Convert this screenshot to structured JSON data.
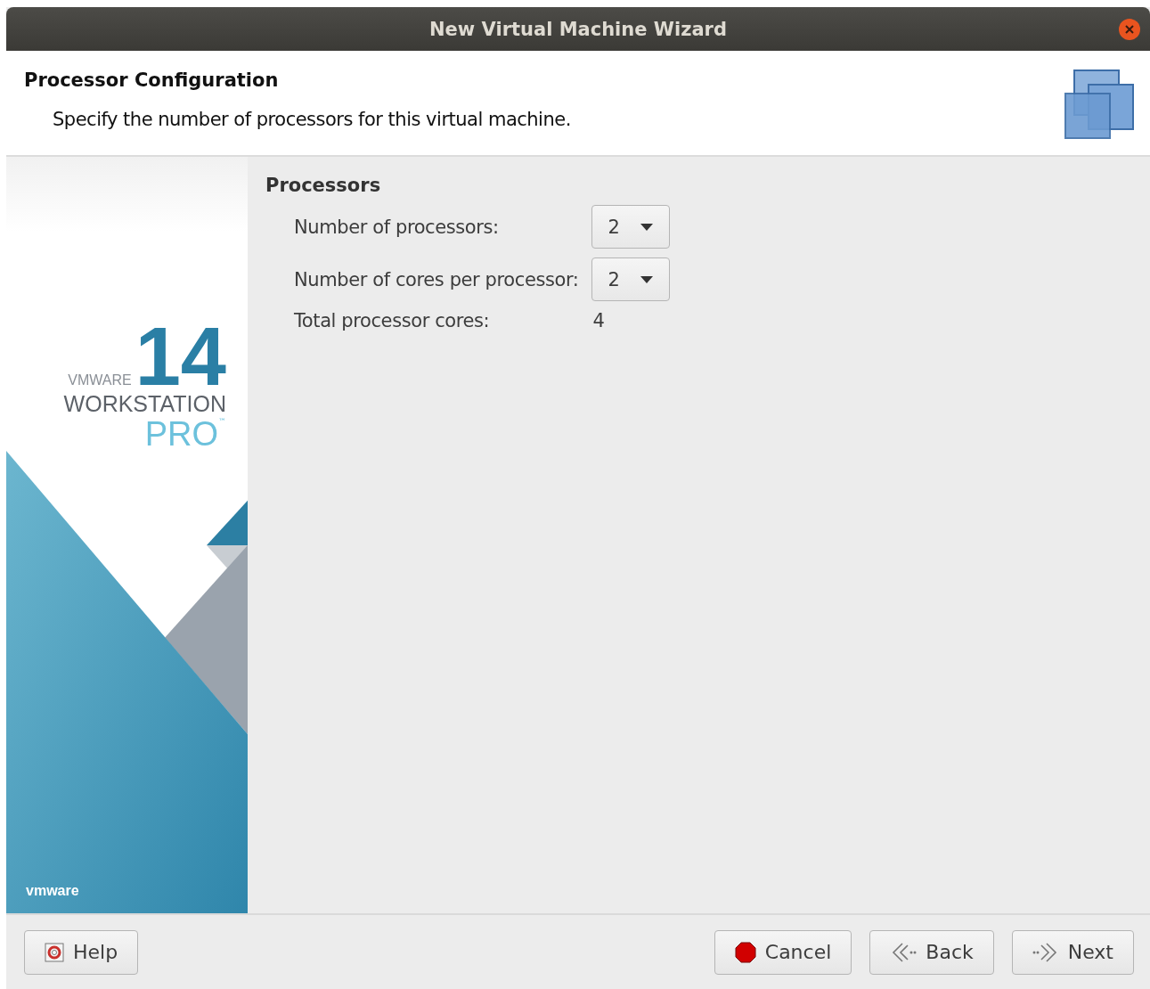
{
  "window": {
    "title": "New Virtual Machine Wizard"
  },
  "header": {
    "title": "Processor Configuration",
    "subtitle": "Specify the number of processors for this virtual machine."
  },
  "sidebar": {
    "vendor": "VMWARE",
    "version": "14",
    "product": "WORKSTATION",
    "edition": "PRO",
    "trademark": "™",
    "footer_logo": "vmware"
  },
  "section": {
    "title": "Processors",
    "fields": [
      {
        "kind": "dropdown",
        "label": "Number of processors:",
        "value": "2"
      },
      {
        "kind": "dropdown",
        "label": "Number of cores per processor:",
        "value": "2"
      },
      {
        "kind": "value",
        "label": "Total processor cores:",
        "value": "4"
      }
    ]
  },
  "buttons": [
    {
      "kind": "help",
      "label": "Help"
    },
    {
      "kind": "cancel",
      "label": "Cancel"
    },
    {
      "kind": "back",
      "label": "Back"
    },
    {
      "kind": "next",
      "label": "Next"
    }
  ]
}
